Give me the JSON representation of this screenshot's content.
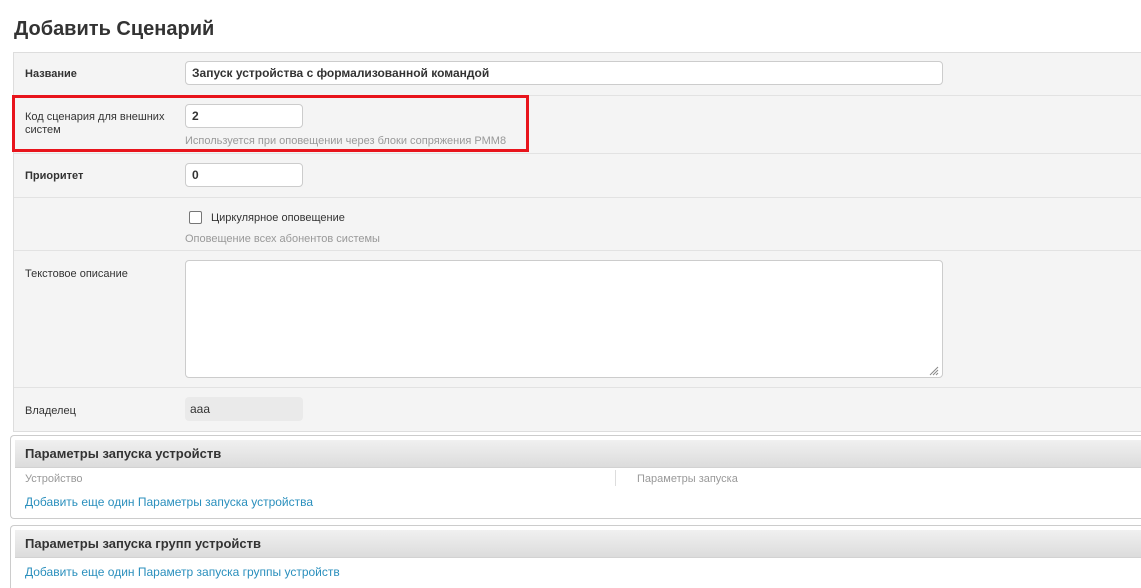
{
  "page": {
    "title": "Добавить Сценарий"
  },
  "form": {
    "name": {
      "label": "Название",
      "value": "Запуск устройства с формализованной командой"
    },
    "external_code": {
      "label": "Код сценария для внешних систем",
      "value": "2",
      "help": "Используется при оповещении через блоки сопряжения РММ8"
    },
    "priority": {
      "label": "Приоритет",
      "value": "0"
    },
    "circular": {
      "label": "Циркулярное оповещение",
      "checked": false,
      "help": "Оповещение всех абонентов системы"
    },
    "description": {
      "label": "Текстовое описание",
      "value": ""
    },
    "owner": {
      "label": "Владелец",
      "value": "aaa"
    }
  },
  "device_params": {
    "title": "Параметры запуска устройств",
    "columns": [
      "Устройство",
      "Параметры запуска"
    ],
    "add_link": "Добавить еще один Параметры запуска устройства"
  },
  "group_params": {
    "title": "Параметры запуска групп устройств",
    "add_link": "Добавить еще один Параметр запуска группы устройств"
  },
  "colors": {
    "highlight": "#e8141c",
    "link": "#2a8fbd",
    "help_text": "#999999"
  }
}
